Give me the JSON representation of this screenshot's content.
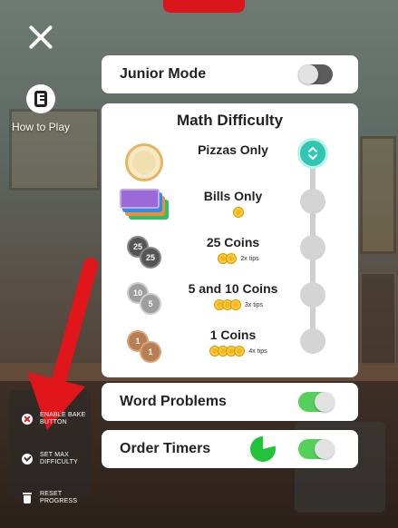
{
  "close": {
    "icon": "close-icon"
  },
  "how_to_play": {
    "label": "How to Play",
    "icon": "book-icon"
  },
  "sidebar_options": [
    {
      "label": "ENABLE BAKE BUTTON",
      "icon": "x-icon"
    },
    {
      "label": "SET MAX DIFFICULTY",
      "icon": "check-icon"
    },
    {
      "label": "RESET PROGRESS",
      "icon": "trash-icon"
    }
  ],
  "junior_mode": {
    "title": "Junior Mode",
    "enabled": false
  },
  "math_difficulty": {
    "title": "Math Difficulty",
    "selected_index": 0,
    "options": [
      {
        "name": "Pizzas Only",
        "tips": ""
      },
      {
        "name": "Bills Only",
        "tips": ""
      },
      {
        "name": "25 Coins",
        "tips": "2x tips",
        "coin_label_a": "25",
        "coin_label_b": "25"
      },
      {
        "name": "5 and 10 Coins",
        "tips": "3x tips",
        "coin_label_a": "10",
        "coin_label_b": "5"
      },
      {
        "name": "1 Coins",
        "tips": "4x tips",
        "coin_label_a": "1",
        "coin_label_b": "1"
      }
    ]
  },
  "word_problems": {
    "title": "Word Problems",
    "enabled": true
  },
  "order_timers": {
    "title": "Order Timers",
    "enabled": true
  },
  "colors": {
    "accent_teal": "#2fc6b3",
    "toggle_on": "#55d05a",
    "arrow_red": "#e0161b"
  }
}
